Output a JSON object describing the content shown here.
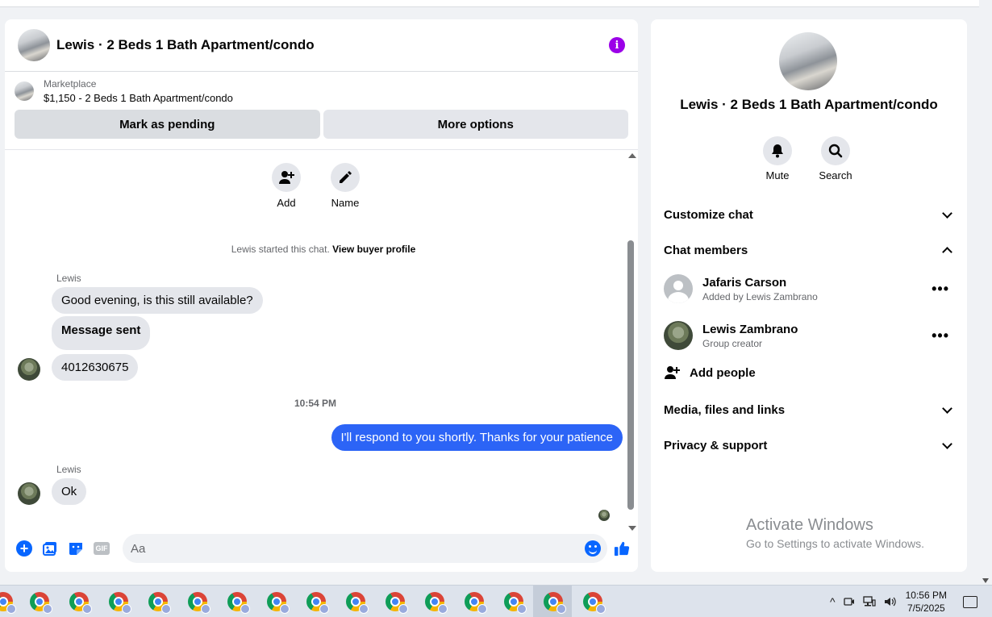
{
  "chat": {
    "title": "Lewis · 2 Beds 1 Bath Apartment/condo",
    "info_icon": "i",
    "marketplace": {
      "label": "Marketplace",
      "listing": "$1,150 - 2 Beds 1 Bath Apartment/condo",
      "mark_pending": "Mark as pending",
      "more_options": "More options"
    },
    "quick_actions": {
      "add": "Add",
      "name": "Name"
    },
    "system_note": {
      "text": "Lewis started this chat. ",
      "link": "View buyer profile"
    },
    "messages": {
      "sender1": "Lewis",
      "m1": "Good evening, is this still available?",
      "m2": "Message sent",
      "m3": "4012630675",
      "timestamp": "10:54 PM",
      "m4": "I'll respond to you shortly. Thanks for your patience",
      "sender2": "Lewis",
      "m5": "Ok"
    },
    "composer": {
      "placeholder": "Aa",
      "gif": "GIF",
      "plus": "+"
    }
  },
  "info": {
    "title": "Lewis · 2 Beds 1 Bath Apartment/condo",
    "mute": "Mute",
    "search": "Search",
    "customize": "Customize chat",
    "members_header": "Chat members",
    "members": [
      {
        "name": "Jafaris Carson",
        "sub": "Added by Lewis Zambrano"
      },
      {
        "name": "Lewis Zambrano",
        "sub": "Group creator"
      }
    ],
    "more": "•••",
    "add_people": "Add people",
    "media": "Media, files and links",
    "privacy": "Privacy & support"
  },
  "watermark": {
    "title": "Activate Windows",
    "sub": "Go to Settings to activate Windows."
  },
  "taskbar": {
    "time": "10:56 PM",
    "date": "7/5/2025",
    "tray_chevron": "^"
  },
  "colors": {
    "accent": "#0866ff",
    "my_bubble": "#2c64f6",
    "info": "#9b00e8"
  }
}
